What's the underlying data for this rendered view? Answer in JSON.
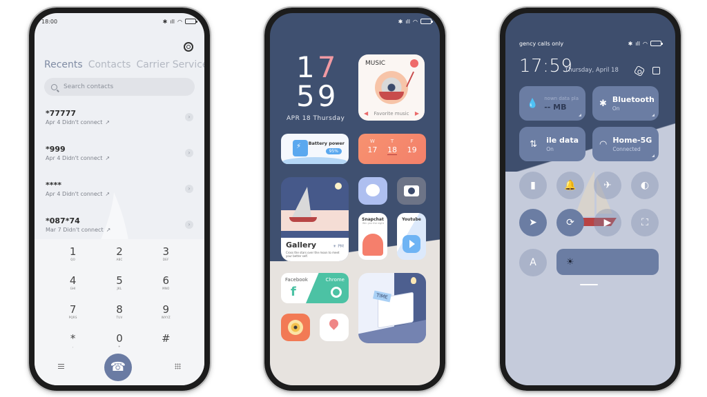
{
  "dialer": {
    "status": {
      "time": "18:00",
      "battery": "☐"
    },
    "settings_icon": "gear-icon",
    "tabs": [
      {
        "label": "Recents",
        "active": true
      },
      {
        "label": "Contacts",
        "active": false
      },
      {
        "label": "Carrier Services",
        "active": false
      }
    ],
    "search": {
      "placeholder": "Search contacts",
      "value": ""
    },
    "calls": [
      {
        "number": "*77777",
        "date": "Apr 4",
        "status": "Didn't connect"
      },
      {
        "number": "*999",
        "date": "Apr 4",
        "status": "Didn't connect"
      },
      {
        "number": "****",
        "date": "Apr 4",
        "status": "Didn't connect"
      },
      {
        "number": "*087*74",
        "date": "Mar 7",
        "status": "Didn't connect"
      }
    ],
    "keys": [
      {
        "digit": "1",
        "letters": "QO"
      },
      {
        "digit": "2",
        "letters": "ABC"
      },
      {
        "digit": "3",
        "letters": "DEF"
      },
      {
        "digit": "4",
        "letters": "GHI"
      },
      {
        "digit": "5",
        "letters": "JKL"
      },
      {
        "digit": "6",
        "letters": "MNO"
      },
      {
        "digit": "7",
        "letters": "PQRS"
      },
      {
        "digit": "8",
        "letters": "TUV"
      },
      {
        "digit": "9",
        "letters": "WXYZ"
      },
      {
        "digit": "*",
        "letters": ","
      },
      {
        "digit": "0",
        "letters": "+"
      },
      {
        "digit": "#",
        "letters": ""
      }
    ],
    "call_button_icon": "☎",
    "accent": "#6a7ba3"
  },
  "home": {
    "clock": {
      "hour_first": "1",
      "hour_second": "7",
      "minutes": "59",
      "date": "APR  18  Thursday"
    },
    "music": {
      "title": "MUSIC",
      "subtitle": "Favorite music",
      "prev": "◀",
      "next": "▶"
    },
    "battery": {
      "label": "Battery power",
      "percent": "95%"
    },
    "calendar": [
      {
        "weekday": "W",
        "day": "17",
        "today": false
      },
      {
        "weekday": "T",
        "day": "18",
        "today": true
      },
      {
        "weekday": "F",
        "day": "19",
        "today": false
      }
    ],
    "gallery": {
      "title": "Gallery",
      "period": "☀ PM",
      "caption": "Cross the stars over the moon to meet your better self."
    },
    "apps": {
      "messenger": "Messenger",
      "camera": "Camera",
      "snapchat": {
        "label": "Snapchat",
        "sub": "Win you the night"
      },
      "youtube": {
        "label": "Youtube"
      },
      "facebook": {
        "label": "Facebook",
        "glyph": "f"
      },
      "chrome": {
        "label": "Chrome"
      },
      "settings": "Settings",
      "maps": "Maps"
    },
    "time_widget": {
      "tag": "TIME"
    },
    "accent_pink": "#f19aa3",
    "background": "#3f5070"
  },
  "control_center": {
    "carrier": "gency calls only",
    "time": "17:59",
    "date": "Thursday, April 18",
    "tiles": [
      {
        "name": "data-plan",
        "icon": "💧",
        "title": "nown data pla",
        "sub": "-- MB"
      },
      {
        "name": "bluetooth",
        "icon": "✱",
        "title": "Bluetooth",
        "sub": "On"
      },
      {
        "name": "mobile-data",
        "icon": "⇅",
        "title": "ile data",
        "sub": "On"
      },
      {
        "name": "wifi",
        "icon": "◠",
        "title": "Home-5G",
        "sub": "Connected"
      }
    ],
    "toggles": [
      {
        "name": "flashlight",
        "glyph": "▮",
        "on": false
      },
      {
        "name": "bell",
        "glyph": "🔔",
        "on": false
      },
      {
        "name": "airplane",
        "glyph": "✈",
        "on": false
      },
      {
        "name": "dark-mode",
        "glyph": "◐",
        "on": false
      },
      {
        "name": "location",
        "glyph": "➤",
        "on": true
      },
      {
        "name": "rotation-lock",
        "glyph": "⟳",
        "on": true
      },
      {
        "name": "screen-record",
        "glyph": "▶",
        "on": false
      },
      {
        "name": "scan",
        "glyph": "⛶",
        "on": false
      },
      {
        "name": "auto-brightness",
        "glyph": "A",
        "on": false
      }
    ],
    "brightness_icon": "☀",
    "accent": "#6b7da3"
  }
}
